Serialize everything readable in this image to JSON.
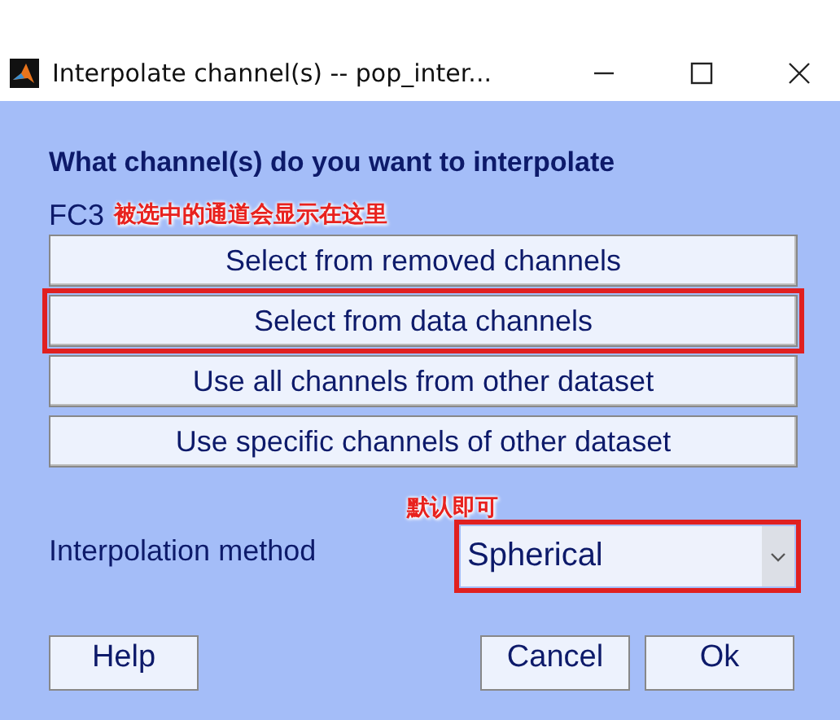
{
  "window": {
    "title": "Interpolate channel(s) -- pop_inter..."
  },
  "heading": "What channel(s) do you want to interpolate",
  "selection": {
    "value": "FC3",
    "annotation": "被选中的通道会显示在这里"
  },
  "choice_buttons": [
    {
      "label": "Select from removed channels",
      "highlighted": false
    },
    {
      "label": "Select from data channels",
      "highlighted": true
    },
    {
      "label": "Use all channels from other dataset",
      "highlighted": false
    },
    {
      "label": "Use specific channels of other dataset",
      "highlighted": false
    }
  ],
  "method": {
    "label": "Interpolation method",
    "annotation": "默认即可",
    "value": "Spherical",
    "highlighted": true
  },
  "footer_buttons": [
    "Help",
    "Cancel",
    "Ok"
  ]
}
